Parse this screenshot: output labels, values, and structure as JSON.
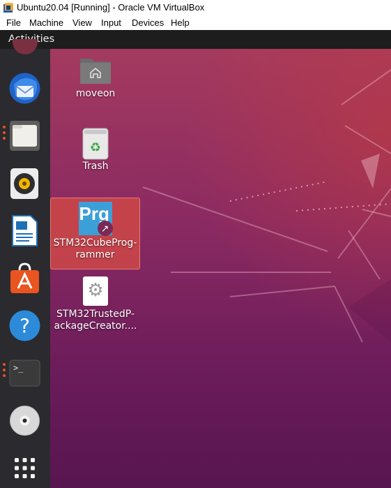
{
  "window": {
    "title": "Ubuntu20.04 [Running] - Oracle VM VirtualBox",
    "menu": [
      "File",
      "Machine",
      "View",
      "Input",
      "Devices",
      "Help"
    ]
  },
  "topbar": {
    "activities": "Activities"
  },
  "dock": {
    "items": [
      {
        "name": "thunderbird-mail",
        "running": false
      },
      {
        "name": "files",
        "running": true
      },
      {
        "name": "rhythmbox",
        "running": false
      },
      {
        "name": "libreoffice-writer",
        "running": false
      },
      {
        "name": "ubuntu-software",
        "running": false
      },
      {
        "name": "help",
        "running": false
      },
      {
        "name": "terminal",
        "running": true
      },
      {
        "name": "dvd-drive",
        "running": false
      },
      {
        "name": "show-applications",
        "running": false
      }
    ]
  },
  "desktop": {
    "icons": [
      {
        "label": "moveon",
        "icon": "home-folder-icon",
        "selected": false
      },
      {
        "label": "Trash",
        "icon": "trash-icon",
        "selected": false
      },
      {
        "label_lines": [
          "STM32CubeProg-",
          "rammer"
        ],
        "icon": "stm32-programmer-icon",
        "icon_text": "Prg",
        "selected": true
      },
      {
        "label_lines": [
          "STM32TrustedP-",
          "ackageCreator...."
        ],
        "icon": "settings-gear-icon",
        "selected": false
      }
    ]
  },
  "colors": {
    "ubuntu_orange": "#e95420",
    "dock_bg": "#2b2a2e",
    "topbar_bg": "#1d1d1d",
    "selection": "#ce4848"
  }
}
